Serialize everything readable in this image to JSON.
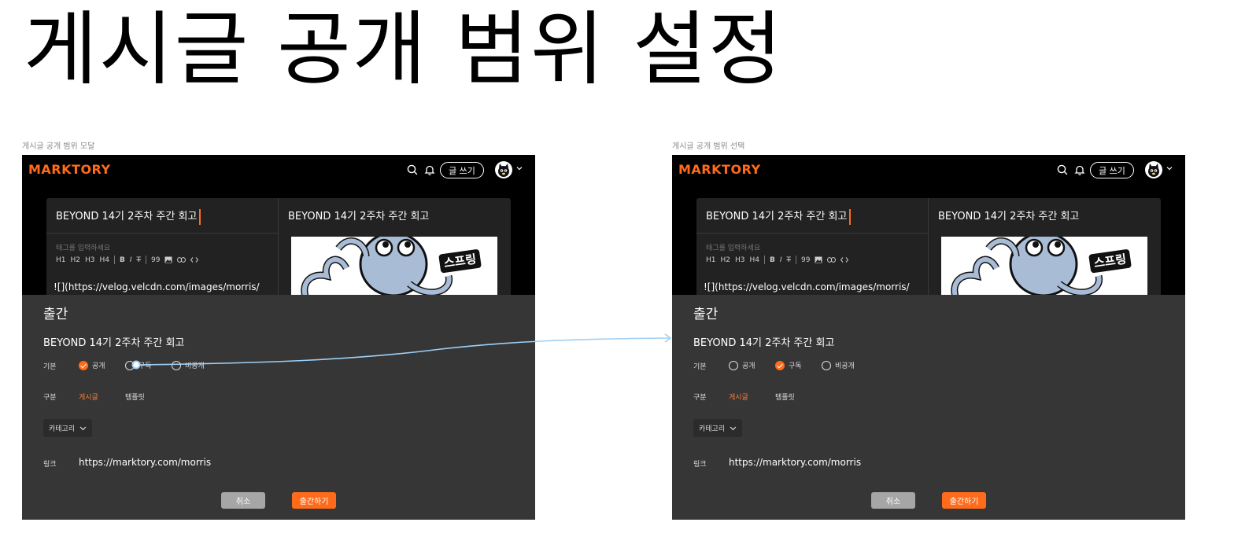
{
  "page": {
    "heading": "게시글 공개 범위 설정"
  },
  "frames": [
    {
      "label": "게시글 공개 범위 모달",
      "app": {
        "logo": "MARKTORY",
        "write_button": "글 쓰기",
        "icons": [
          "search-icon",
          "bell-icon",
          "avatar",
          "chevron-down-icon"
        ]
      },
      "editor": {
        "title": "BEYOND 14기 2주차 주간 회고",
        "tag_placeholder": "태그를 입력하세요",
        "toolbar": [
          "H1",
          "H2",
          "H3",
          "H4",
          "B",
          "I",
          "T",
          "99",
          "image",
          "link",
          "<>"
        ],
        "markdown_line": "![](https://velog.velcdn.com/images/morris/",
        "preview_title": "BEYOND 14기 2주차 주간 회고",
        "preview_badge": "스프링"
      },
      "modal": {
        "title": "출간",
        "post_title": "BEYOND 14기 2주차 주간 회고",
        "visibility_label": "기본",
        "visibility_options": [
          "공개",
          "구독",
          "비공개"
        ],
        "visibility_selected": "공개",
        "kind_label": "구분",
        "kind_options": [
          "게시글",
          "템플릿"
        ],
        "kind_selected": "게시글",
        "category": "카테고리",
        "link_label": "링크",
        "link": "https://marktory.com/morris",
        "cancel": "취소",
        "publish": "출간하기"
      }
    },
    {
      "label": "게시글 공개 범위 선택",
      "app": {
        "logo": "MARKTORY",
        "write_button": "글 쓰기",
        "icons": [
          "search-icon",
          "bell-icon",
          "avatar",
          "chevron-down-icon"
        ]
      },
      "editor": {
        "title": "BEYOND 14기 2주차 주간 회고",
        "tag_placeholder": "태그를 입력하세요",
        "toolbar": [
          "H1",
          "H2",
          "H3",
          "H4",
          "B",
          "I",
          "T",
          "99",
          "image",
          "link",
          "<>"
        ],
        "markdown_line": "![](https://velog.velcdn.com/images/morris/",
        "preview_title": "BEYOND 14기 2주차 주간 회고",
        "preview_badge": "스프링"
      },
      "modal": {
        "title": "출간",
        "post_title": "BEYOND 14기 2주차 주간 회고",
        "visibility_label": "기본",
        "visibility_options": [
          "공개",
          "구독",
          "비공개"
        ],
        "visibility_selected": "구독",
        "kind_label": "구분",
        "kind_options": [
          "게시글",
          "템플릿"
        ],
        "kind_selected": "게시글",
        "category": "카테고리",
        "link_label": "링크",
        "link": "https://marktory.com/morris",
        "cancel": "취소",
        "publish": "출간하기"
      }
    }
  ],
  "colors": {
    "accent": "#ff6b1a",
    "app_bg": "#000000",
    "editor_bg": "#222222",
    "modal_bg": "#363636",
    "connector": "#9fd0f5"
  }
}
